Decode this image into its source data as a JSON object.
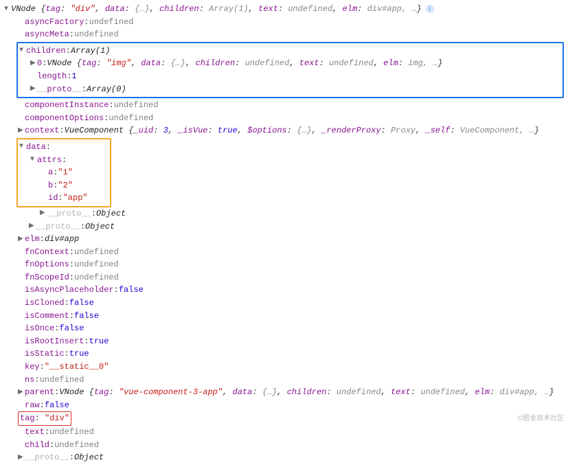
{
  "root": {
    "class": "VNode",
    "summary_tag": "\"div\"",
    "summary_data": "{…}",
    "summary_children": "Array(1)",
    "summary_text": "undefined",
    "summary_elm": "div#app",
    "summary_trail": ", …"
  },
  "props": {
    "asyncFactory": {
      "k": "asyncFactory",
      "v": "undefined",
      "t": "undef"
    },
    "asyncMeta": {
      "k": "asyncMeta",
      "v": "undefined",
      "t": "undef"
    },
    "children_label": "children",
    "children_val": "Array(1)",
    "child0": {
      "idx": "0",
      "class": "VNode",
      "tag": "\"img\"",
      "data": "{…}",
      "children": "undefined",
      "text": "undefined",
      "elm": "img",
      "trail": ", …"
    },
    "length": {
      "k": "length",
      "v": "1"
    },
    "proto_arr": {
      "k": "__proto__",
      "v": "Array(0)"
    },
    "componentInstance": {
      "k": "componentInstance",
      "v": "undefined",
      "t": "undef"
    },
    "componentOptions": {
      "k": "componentOptions",
      "v": "undefined",
      "t": "undef"
    },
    "context": {
      "k": "context",
      "class": "VueComponent",
      "uid_k": "_uid",
      "uid_v": "3",
      "isvue_k": "_isVue",
      "isvue_v": "true",
      "opts_k": "$options",
      "opts_v": "{…}",
      "rp_k": "_renderProxy",
      "rp_v": "Proxy",
      "self_k": "_self",
      "self_v": "VueComponent",
      "trail": ", …"
    },
    "data_label": "data",
    "attrs_label": "attrs",
    "attr_a": {
      "k": "a",
      "v": "\"1\""
    },
    "attr_b": {
      "k": "b",
      "v": "\"2\""
    },
    "attr_id": {
      "k": "id",
      "v": "\"app\""
    },
    "proto_obj1": {
      "k": "__proto__",
      "v": "Object"
    },
    "proto_obj2": {
      "k": "__proto__",
      "v": "Object"
    },
    "elm": {
      "k": "elm",
      "v": "div#app"
    },
    "fnContext": {
      "k": "fnContext",
      "v": "undefined",
      "t": "undef"
    },
    "fnOptions": {
      "k": "fnOptions",
      "v": "undefined",
      "t": "undef"
    },
    "fnScopeId": {
      "k": "fnScopeId",
      "v": "undefined",
      "t": "undef"
    },
    "isAsyncPlaceholder": {
      "k": "isAsyncPlaceholder",
      "v": "false",
      "t": "bool"
    },
    "isCloned": {
      "k": "isCloned",
      "v": "false",
      "t": "bool"
    },
    "isComment": {
      "k": "isComment",
      "v": "false",
      "t": "bool"
    },
    "isOnce": {
      "k": "isOnce",
      "v": "false",
      "t": "bool"
    },
    "isRootInsert": {
      "k": "isRootInsert",
      "v": "true",
      "t": "bool"
    },
    "isStatic": {
      "k": "isStatic",
      "v": "true",
      "t": "bool"
    },
    "key": {
      "k": "key",
      "v": "\"__static__0\"",
      "t": "str"
    },
    "ns": {
      "k": "ns",
      "v": "undefined",
      "t": "undef"
    },
    "parent": {
      "k": "parent",
      "class": "VNode",
      "tag": "\"vue-component-3-app\"",
      "data": "{…}",
      "children": "undefined",
      "text": "undefined",
      "elm": "div#app",
      "trail": ", …"
    },
    "raw": {
      "k": "raw",
      "v": "false",
      "t": "bool"
    },
    "tag": {
      "k": "tag",
      "v": "\"div\"",
      "t": "str"
    },
    "text": {
      "k": "text",
      "v": "undefined",
      "t": "undef"
    },
    "child": {
      "k": "child",
      "v": "undefined",
      "t": "undef"
    },
    "proto_obj3": {
      "k": "__proto__",
      "v": "Object"
    }
  },
  "watermark": "©图金技术社区"
}
